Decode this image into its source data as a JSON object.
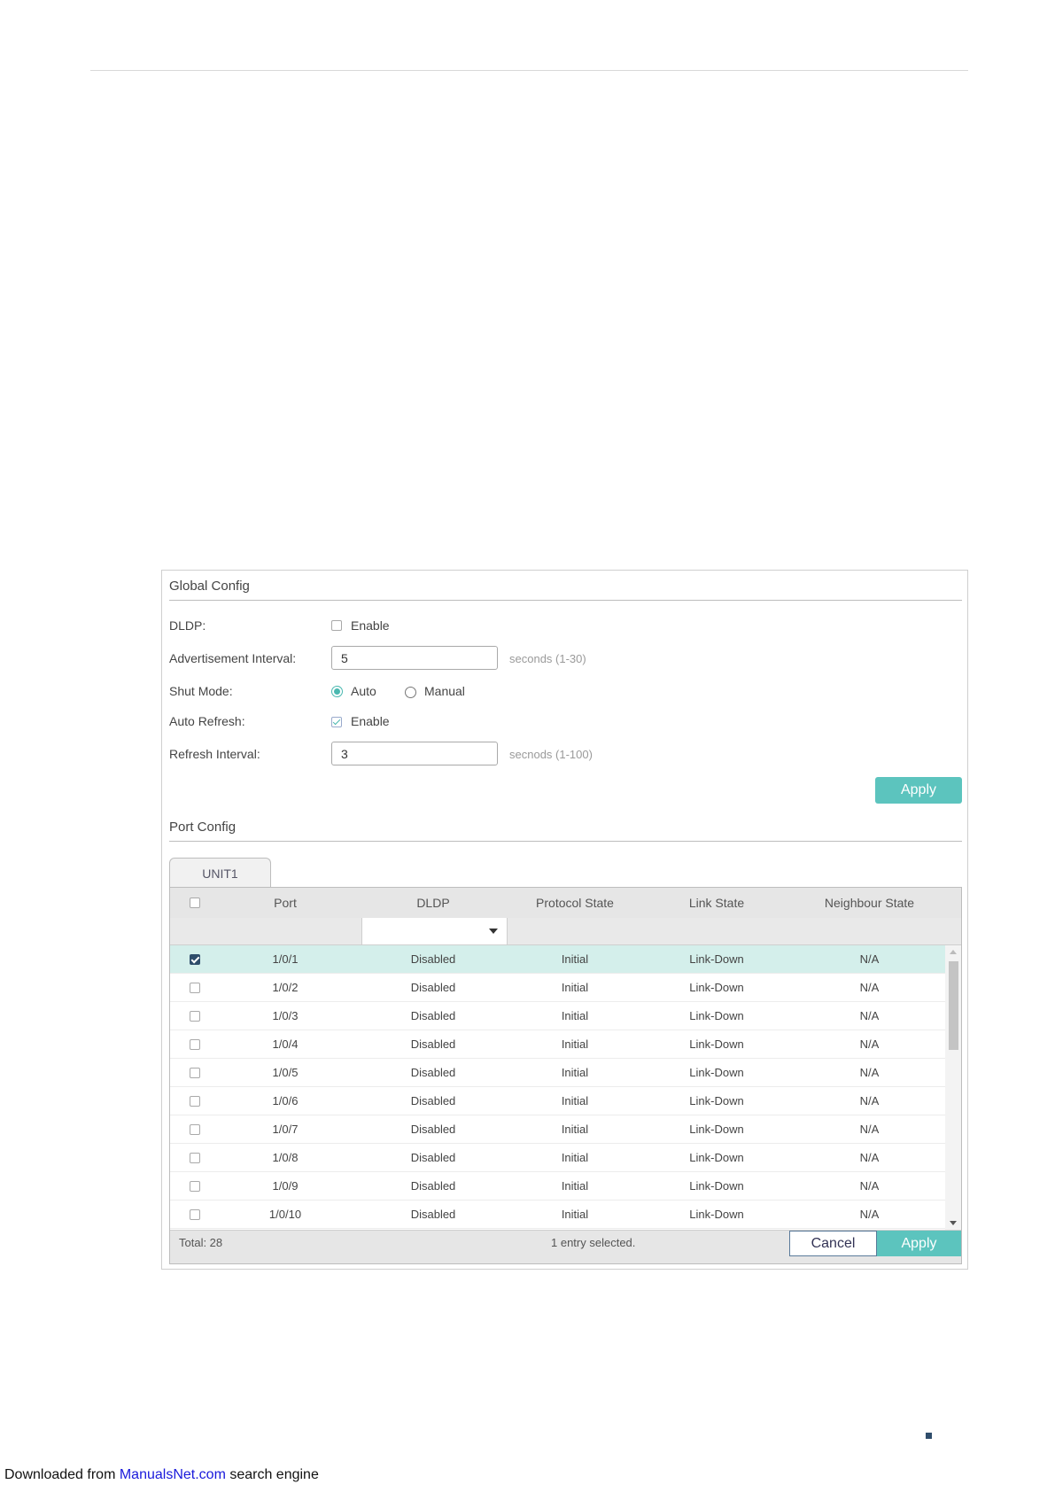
{
  "global_config": {
    "title": "Global Config",
    "dldp_label": "DLDP:",
    "dldp_option": "Enable",
    "dldp_enabled": false,
    "adv_interval_label": "Advertisement Interval:",
    "adv_interval_value": "5",
    "adv_interval_hint": "seconds (1-30)",
    "shut_mode_label": "Shut Mode:",
    "shut_mode_options": [
      "Auto",
      "Manual"
    ],
    "shut_mode_selected": "Auto",
    "auto_refresh_label": "Auto Refresh:",
    "auto_refresh_option": "Enable",
    "auto_refresh_enabled": true,
    "refresh_interval_label": "Refresh Interval:",
    "refresh_interval_value": "3",
    "refresh_interval_hint": "secnods (1-100)",
    "apply_label": "Apply"
  },
  "port_config": {
    "title": "Port Config",
    "tab_label": "UNIT1",
    "columns": [
      "Port",
      "DLDP",
      "Protocol State",
      "Link State",
      "Neighbour State"
    ],
    "rows": [
      {
        "port": "1/0/1",
        "dldp": "Disabled",
        "protocol_state": "Initial",
        "link_state": "Link-Down",
        "neighbour_state": "N/A",
        "selected": true
      },
      {
        "port": "1/0/2",
        "dldp": "Disabled",
        "protocol_state": "Initial",
        "link_state": "Link-Down",
        "neighbour_state": "N/A",
        "selected": false
      },
      {
        "port": "1/0/3",
        "dldp": "Disabled",
        "protocol_state": "Initial",
        "link_state": "Link-Down",
        "neighbour_state": "N/A",
        "selected": false
      },
      {
        "port": "1/0/4",
        "dldp": "Disabled",
        "protocol_state": "Initial",
        "link_state": "Link-Down",
        "neighbour_state": "N/A",
        "selected": false
      },
      {
        "port": "1/0/5",
        "dldp": "Disabled",
        "protocol_state": "Initial",
        "link_state": "Link-Down",
        "neighbour_state": "N/A",
        "selected": false
      },
      {
        "port": "1/0/6",
        "dldp": "Disabled",
        "protocol_state": "Initial",
        "link_state": "Link-Down",
        "neighbour_state": "N/A",
        "selected": false
      },
      {
        "port": "1/0/7",
        "dldp": "Disabled",
        "protocol_state": "Initial",
        "link_state": "Link-Down",
        "neighbour_state": "N/A",
        "selected": false
      },
      {
        "port": "1/0/8",
        "dldp": "Disabled",
        "protocol_state": "Initial",
        "link_state": "Link-Down",
        "neighbour_state": "N/A",
        "selected": false
      },
      {
        "port": "1/0/9",
        "dldp": "Disabled",
        "protocol_state": "Initial",
        "link_state": "Link-Down",
        "neighbour_state": "N/A",
        "selected": false
      },
      {
        "port": "1/0/10",
        "dldp": "Disabled",
        "protocol_state": "Initial",
        "link_state": "Link-Down",
        "neighbour_state": "N/A",
        "selected": false
      }
    ],
    "total_text": "Total: 28",
    "selected_text": "1 entry selected.",
    "cancel_label": "Cancel",
    "apply_label": "Apply"
  },
  "footer": {
    "prefix": "Downloaded from ",
    "link": "ManualsNet.com",
    "suffix": " search engine"
  },
  "colors": {
    "accent": "#5cc4be",
    "selected_row": "#d4efeb",
    "checkbox_selected": "#2f4d6b",
    "link": "#1a1adb"
  }
}
